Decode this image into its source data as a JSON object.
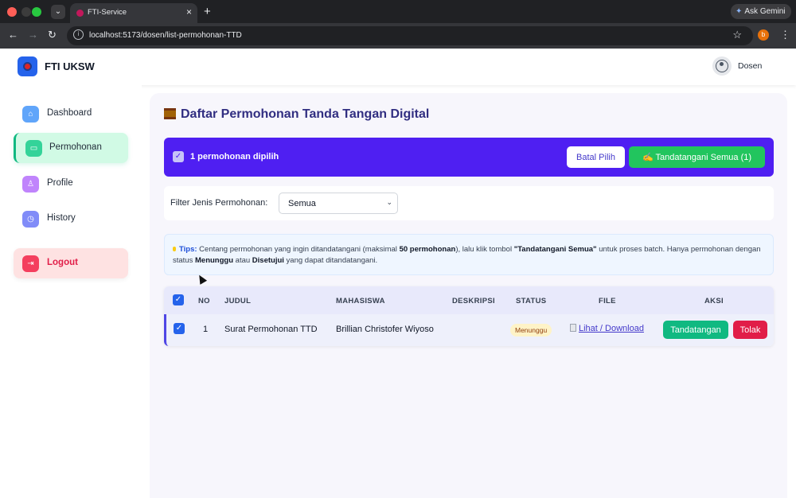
{
  "browser": {
    "tab_title": "FTI-Service",
    "new_tab": "+",
    "close_tab": "×",
    "gemini_label": "Ask Gemini",
    "url": "localhost:5173/dosen/list-permohonan-TTD",
    "profile_initial": "b"
  },
  "header": {
    "brand": "FTI UKSW",
    "user": "Dosen"
  },
  "sidebar": {
    "items": [
      {
        "label": "Dashboard",
        "icon": "home-icon"
      },
      {
        "label": "Permohonan",
        "icon": "inbox-icon",
        "active": true
      },
      {
        "label": "Profile",
        "icon": "user-icon"
      },
      {
        "label": "History",
        "icon": "clock-icon"
      }
    ],
    "logout": "Logout"
  },
  "main": {
    "title": "Daftar Permohonan Tanda Tangan Digital",
    "selection": {
      "text": "1 permohonan dipilih",
      "cancel": "Batal Pilih",
      "sign_all": "✍ Tandatangani Semua (1)"
    },
    "filter": {
      "label": "Filter Jenis Permohonan:",
      "value": "Semua"
    },
    "tips": {
      "head": "Tips:",
      "p1": " Centang permohonan yang ingin ditandatangani (maksimal ",
      "b1": "50 permohonan",
      "p2": "), lalu klik tombol ",
      "b2": "\"Tandatangani Semua\"",
      "p3": " untuk proses batch. Hanya permohonan dengan status ",
      "b3": "Menunggu",
      "p4": " atau ",
      "b4": "Disetujui",
      "p5": " yang dapat ditandatangani."
    },
    "table": {
      "headers": {
        "no": "NO",
        "judul": "JUDUL",
        "mahasiswa": "MAHASISWA",
        "deskripsi": "DESKRIPSI",
        "status": "STATUS",
        "file": "FILE",
        "aksi": "AKSI"
      },
      "rows": [
        {
          "no": "1",
          "judul": "Surat Permohonan TTD",
          "mahasiswa": "Brillian Christofer Wiyoso",
          "deskripsi": "",
          "status": "Menunggu",
          "file": "Lihat / Download",
          "sign": "Tandatangan",
          "reject": "Tolak"
        }
      ]
    }
  },
  "colors": {
    "accent": "#4f1ff2",
    "success": "#22c55e",
    "danger": "#e11d48",
    "title": "#312e81"
  }
}
